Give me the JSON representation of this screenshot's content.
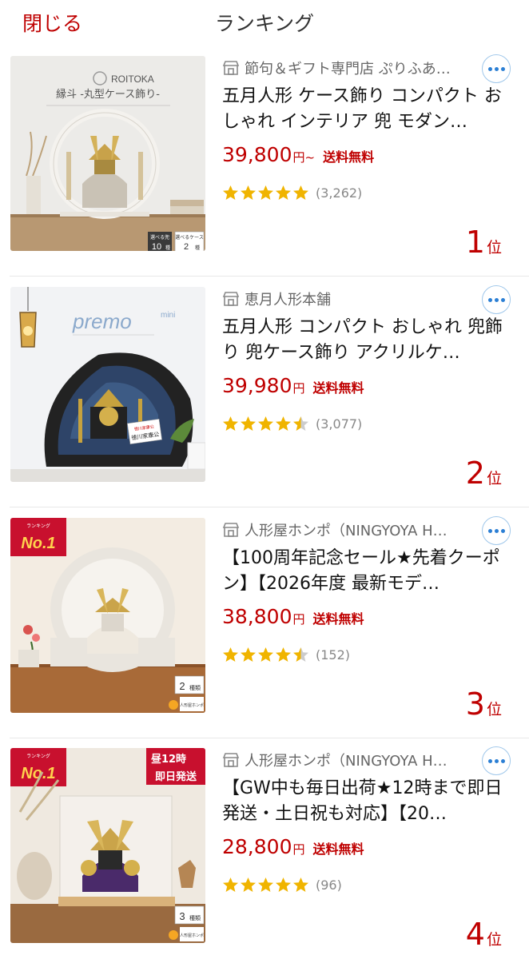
{
  "header": {
    "close_label": "閉じる",
    "title": "ランキング"
  },
  "items": [
    {
      "shop": "節句＆ギフト専門店 ぷりふあ…",
      "title": "五月人形 ケース飾り コンパクト おしゃれ インテリア 兜 モダン…",
      "price": "39,800",
      "yen": "円~",
      "shipping": "送料無料",
      "rating": 5,
      "reviews": "(3,262)",
      "rank": "1",
      "rank_suffix": "位",
      "image": {
        "brand": "ROITOKA",
        "caption": "縁斗 -丸型ケース飾り-",
        "badge_a_label": "選べる兜",
        "badge_a_count": "10",
        "badge_a_unit": "種",
        "badge_b_label": "選べるケース",
        "badge_b_count": "2",
        "badge_b_unit": "種"
      }
    },
    {
      "shop": "恵月人形本舗",
      "title": "五月人形 コンパクト おしゃれ 兜飾り 兜ケース飾り アクリルケ…",
      "price": "39,980",
      "yen": "円",
      "shipping": "送料無料",
      "rating": 4.5,
      "reviews": "(3,077)",
      "rank": "2",
      "rank_suffix": "位",
      "image": {
        "brand": "premo",
        "brand_sub": "mini",
        "nameplate_top": "徳川家康公",
        "nameplate": "徳川家康公"
      }
    },
    {
      "shop": "人形屋ホンポ（NINGYOYA H…",
      "title": "【100周年記念セール★先着クーポン】【2026年度 最新モデ…",
      "price": "38,800",
      "yen": "円",
      "shipping": "送料無料",
      "rating": 4.5,
      "reviews": "(152)",
      "rank": "3",
      "rank_suffix": "位",
      "image": {
        "ribbon_top": "ランキング",
        "ribbon_main": "No.1",
        "variant_count": "2",
        "variant_label": "種類",
        "logo": "人形屋ホンポ"
      }
    },
    {
      "shop": "人形屋ホンポ（NINGYOYA H…",
      "title": "【GW中も毎日出荷★12時まで即日発送・土日祝も対応】【20…",
      "price": "28,800",
      "yen": "円",
      "shipping": "送料無料",
      "rating": 5,
      "reviews": "(96)",
      "rank": "4",
      "rank_suffix": "位",
      "image": {
        "ribbon_top": "ランキング",
        "ribbon_main": "No.1",
        "ship_top": "昼12時",
        "ship_main": "即日発送",
        "variant_count": "3",
        "variant_label": "種類",
        "logo": "人形屋ホンポ"
      }
    }
  ],
  "colors": {
    "accent": "#bf0000",
    "star": "#f0b400",
    "star_empty": "#cccccc",
    "more_dots": "#2b7fd4"
  },
  "icons": {
    "shop": "shop-icon",
    "more": "more-options-icon",
    "star": "star-icon"
  }
}
